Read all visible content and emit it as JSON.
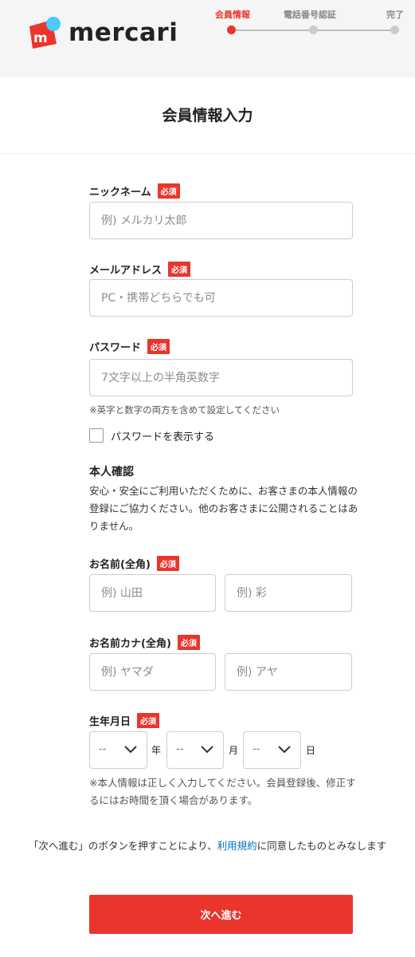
{
  "brand": {
    "name": "mercari",
    "color": "#ea352d"
  },
  "steps": [
    {
      "label": "会員情報",
      "active": true
    },
    {
      "label": "電話番号認証",
      "active": false
    },
    {
      "label": "完了",
      "active": false
    }
  ],
  "page_title": "会員情報入力",
  "required_badge": "必須",
  "fields": {
    "nickname": {
      "label": "ニックネーム",
      "placeholder": "例) メルカリ太郎",
      "value": ""
    },
    "email": {
      "label": "メールアドレス",
      "placeholder": "PC・携帯どちらでも可",
      "value": ""
    },
    "password": {
      "label": "パスワード",
      "placeholder": "7文字以上の半角英数字",
      "value": ""
    }
  },
  "password_note": "※英字と数字の両方を含めて設定してください",
  "show_password_label": "パスワードを表示する",
  "identity": {
    "title": "本人確認",
    "description": "安心・安全にご利用いただくために、お客さまの本人情報の登録にご協力ください。他のお客さまに公開されることはありません。"
  },
  "name_kanji": {
    "label": "お名前(全角)",
    "last_placeholder": "例) 山田",
    "first_placeholder": "例) 彩"
  },
  "name_kana": {
    "label": "お名前カナ(全角)",
    "last_placeholder": "例) ヤマダ",
    "first_placeholder": "例) アヤ"
  },
  "birthday": {
    "label": "生年月日",
    "year_value": "--",
    "month_value": "--",
    "day_value": "--",
    "year_unit": "年",
    "month_unit": "月",
    "day_unit": "日"
  },
  "birthday_note": "※本人情報は正しく入力してください。会員登録後、修正するにはお時間を頂く場合があります。",
  "terms": {
    "before": "「次へ進む」のボタンを押すことにより、",
    "link": "利用規約",
    "after": "に同意したものとみなします"
  },
  "submit_label": "次へ進む"
}
